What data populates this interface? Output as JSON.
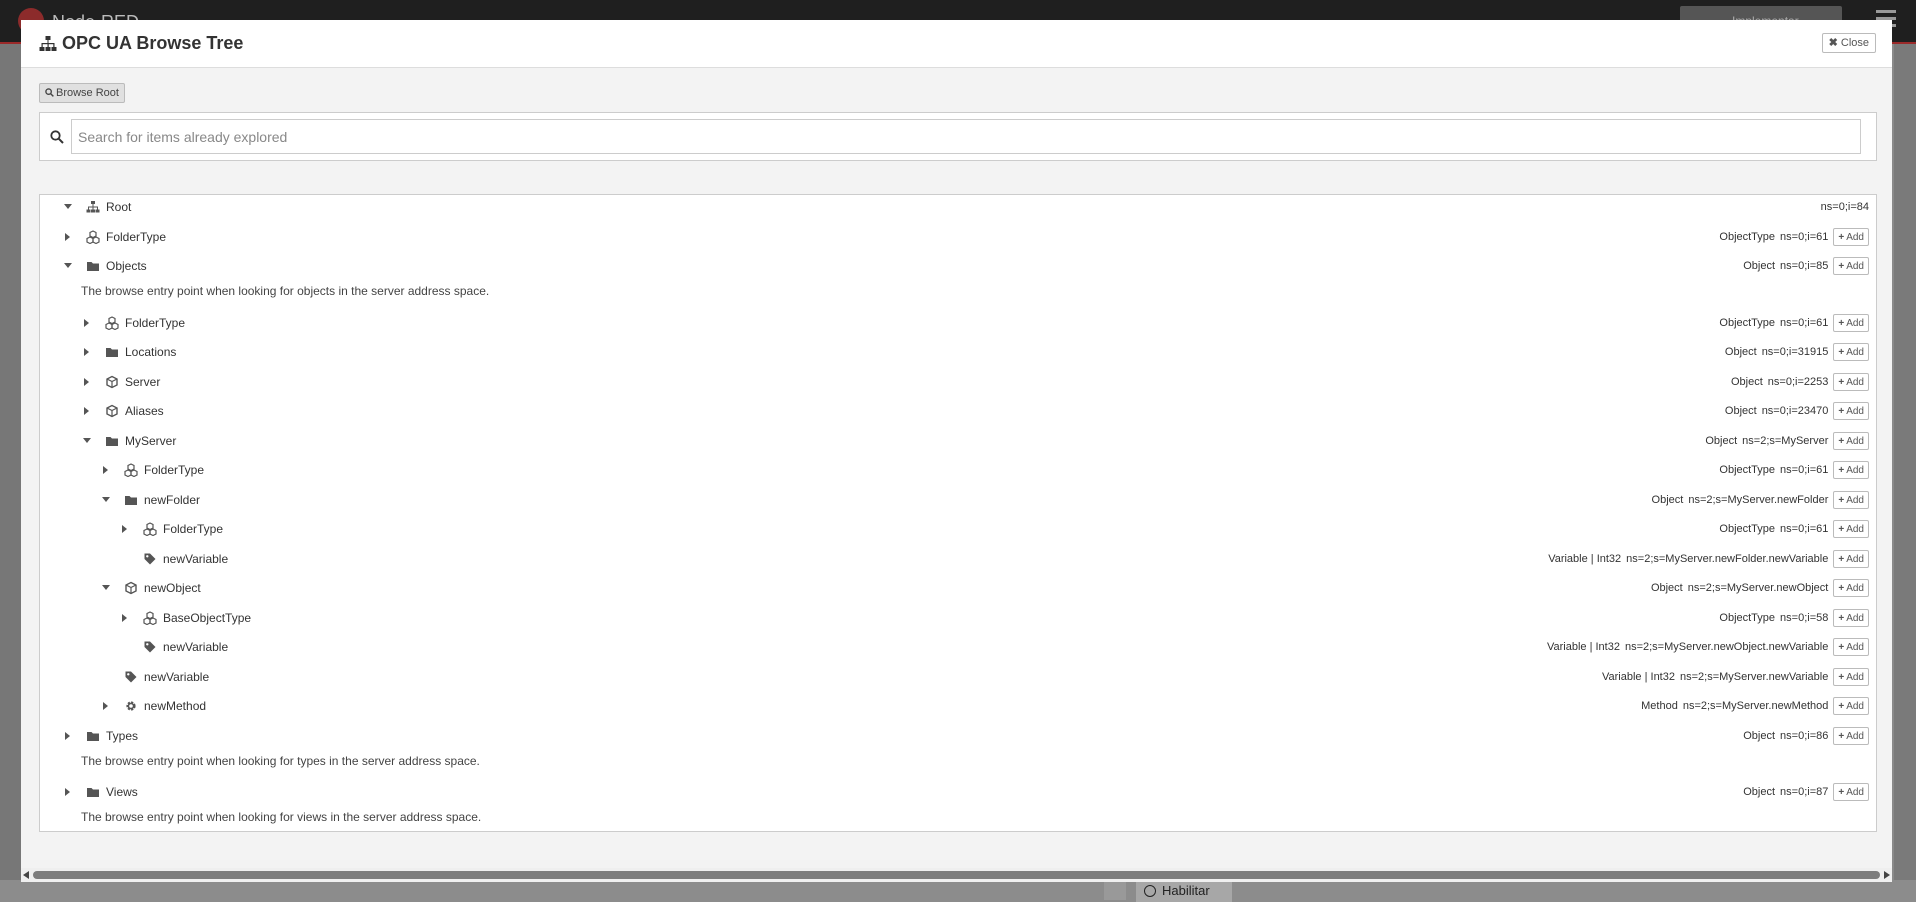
{
  "background": {
    "brand": "Node-RED",
    "deploy_label": "Implementar",
    "habilitar_label": "Habilitar"
  },
  "dialog": {
    "title": "OPC UA Browse Tree",
    "close_label": "Close",
    "browse_root_label": "Browse Root",
    "search_placeholder": "Search for items already explored"
  },
  "add_label": "Add",
  "tree": [
    {
      "label": "Root",
      "type": "",
      "id": "ns=0;i=84",
      "icon": "sitemap",
      "expanded": true,
      "depth": 0,
      "add": false
    },
    {
      "label": "FolderType",
      "type": "ObjectType",
      "id": "ns=0;i=61",
      "icon": "cubes",
      "expanded": false,
      "depth": 0,
      "add": true
    },
    {
      "label": "Objects",
      "type": "Object",
      "id": "ns=0;i=85",
      "icon": "folder",
      "expanded": true,
      "depth": 0,
      "add": true,
      "desc": "The browse entry point when looking for objects in the server address space."
    },
    {
      "label": "FolderType",
      "type": "ObjectType",
      "id": "ns=0;i=61",
      "icon": "cubes",
      "expanded": false,
      "depth": 1,
      "add": true
    },
    {
      "label": "Locations",
      "type": "Object",
      "id": "ns=0;i=31915",
      "icon": "folder",
      "expanded": false,
      "depth": 1,
      "add": true
    },
    {
      "label": "Server",
      "type": "Object",
      "id": "ns=0;i=2253",
      "icon": "cube",
      "expanded": false,
      "depth": 1,
      "add": true
    },
    {
      "label": "Aliases",
      "type": "Object",
      "id": "ns=0;i=23470",
      "icon": "cube",
      "expanded": false,
      "depth": 1,
      "add": true
    },
    {
      "label": "MyServer",
      "type": "Object",
      "id": "ns=2;s=MyServer",
      "icon": "folder",
      "expanded": true,
      "depth": 1,
      "add": true
    },
    {
      "label": "FolderType",
      "type": "ObjectType",
      "id": "ns=0;i=61",
      "icon": "cubes",
      "expanded": false,
      "depth": 2,
      "add": true
    },
    {
      "label": "newFolder",
      "type": "Object",
      "id": "ns=2;s=MyServer.newFolder",
      "icon": "folder",
      "expanded": true,
      "depth": 2,
      "add": true
    },
    {
      "label": "FolderType",
      "type": "ObjectType",
      "id": "ns=0;i=61",
      "icon": "cubes",
      "expanded": false,
      "depth": 3,
      "add": true
    },
    {
      "label": "newVariable",
      "type": "Variable | Int32",
      "id": "ns=2;s=MyServer.newFolder.newVariable",
      "icon": "tag",
      "leaf": true,
      "depth": 3,
      "add": true
    },
    {
      "label": "newObject",
      "type": "Object",
      "id": "ns=2;s=MyServer.newObject",
      "icon": "cube",
      "expanded": true,
      "depth": 2,
      "add": true
    },
    {
      "label": "BaseObjectType",
      "type": "ObjectType",
      "id": "ns=0;i=58",
      "icon": "cubes",
      "expanded": false,
      "depth": 3,
      "add": true
    },
    {
      "label": "newVariable",
      "type": "Variable | Int32",
      "id": "ns=2;s=MyServer.newObject.newVariable",
      "icon": "tag",
      "leaf": true,
      "depth": 3,
      "add": true
    },
    {
      "label": "newVariable",
      "type": "Variable | Int32",
      "id": "ns=2;s=MyServer.newVariable",
      "icon": "tag",
      "leaf": true,
      "depth": 2,
      "add": true
    },
    {
      "label": "newMethod",
      "type": "Method",
      "id": "ns=2;s=MyServer.newMethod",
      "icon": "gear",
      "expanded": false,
      "depth": 2,
      "add": true
    },
    {
      "label": "Types",
      "type": "Object",
      "id": "ns=0;i=86",
      "icon": "folder",
      "expanded": false,
      "depth": 0,
      "add": true,
      "desc": "The browse entry point when looking for types in the server address space."
    },
    {
      "label": "Views",
      "type": "Object",
      "id": "ns=0;i=87",
      "icon": "folder",
      "expanded": false,
      "depth": 0,
      "add": true,
      "desc": "The browse entry point when looking for views in the server address space."
    }
  ]
}
